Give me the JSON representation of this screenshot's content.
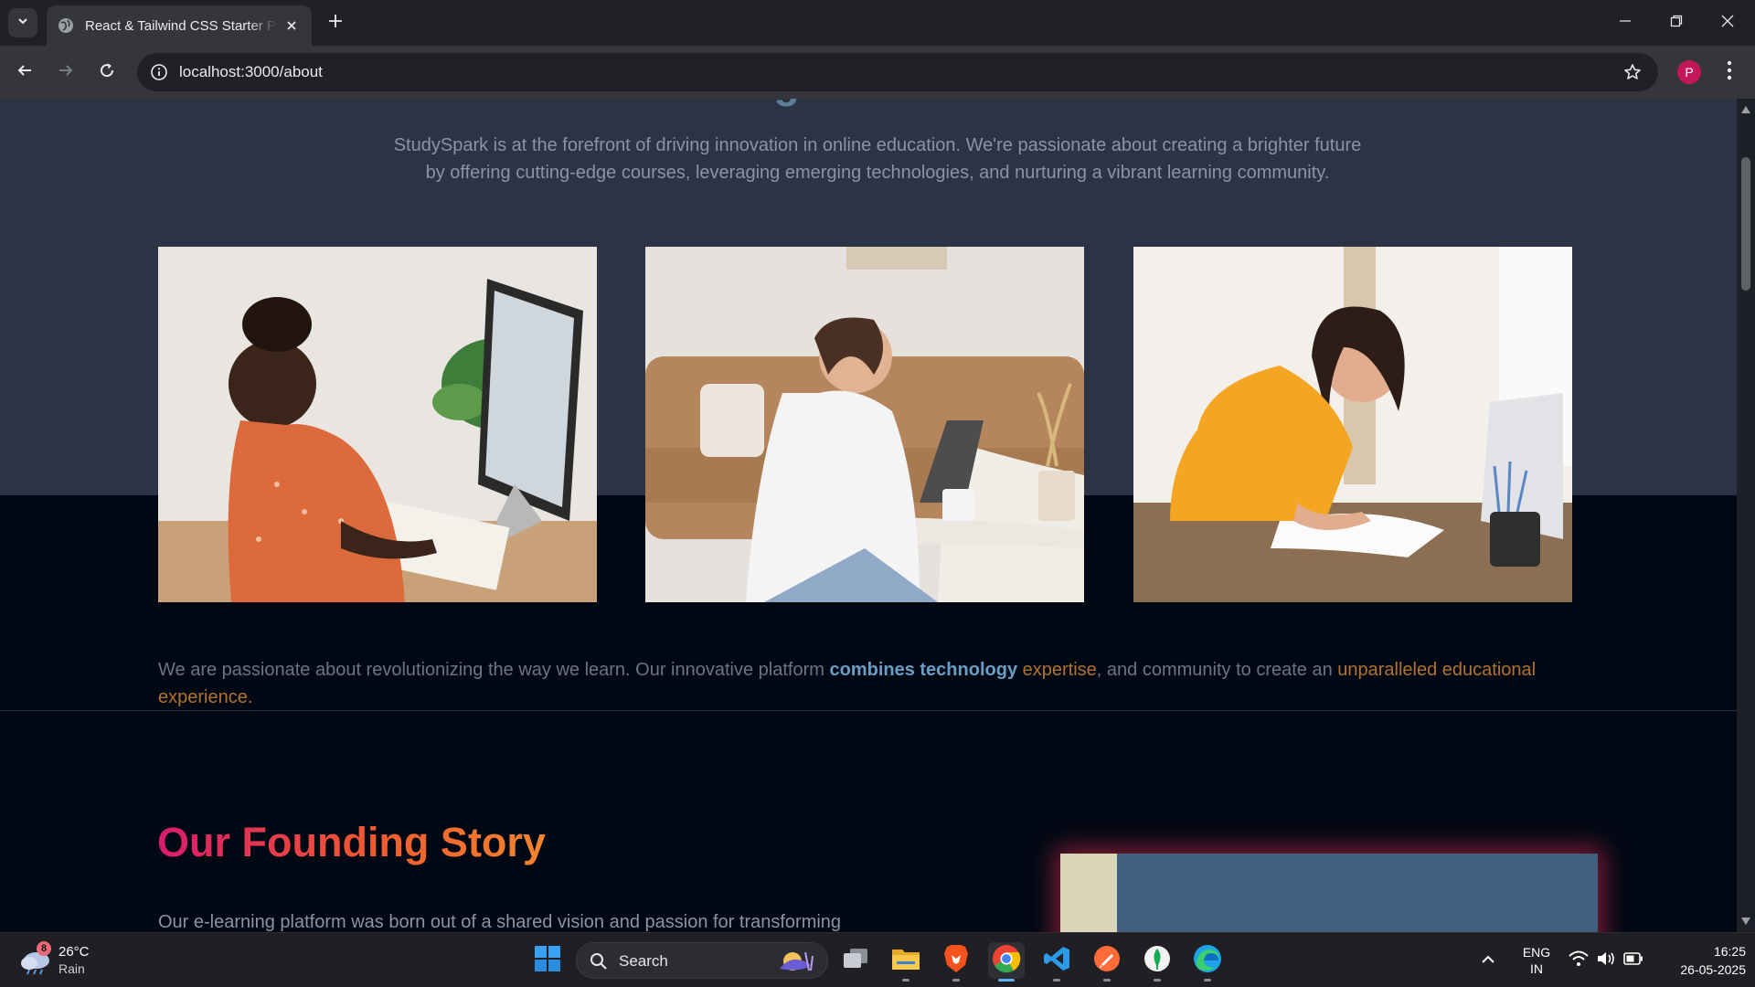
{
  "browser": {
    "tab_title": "React & Tailwind CSS Starter Pack",
    "url": "localhost:3000/about",
    "profile_initial": "P"
  },
  "page": {
    "heading_partial": "Brighter Future",
    "intro_text": "StudySpark is at the forefront of driving innovation in online education. We're passionate about creating a brighter future by offering cutting-edge courses, leveraging emerging technologies, and nurturing a vibrant learning community.",
    "mission": {
      "part1": "We are passionate about revolutionizing the way we learn. Our innovative platform ",
      "highlight1": "combines technology",
      "highlight2": " expertise",
      "part2": ", and community to create an ",
      "highlight3": "unparalleled educational experience."
    },
    "story_title": "Our Founding Story",
    "story_text": "Our e-learning platform was born out of a shared vision and passion for transforming"
  },
  "taskbar": {
    "weather_badge": "8",
    "temperature": "26°C",
    "condition": "Rain",
    "search_label": "Search",
    "lang_line1": "ENG",
    "lang_line2": "IN",
    "time": "16:25",
    "date": "26-05-2025"
  },
  "colors": {
    "page_bg": "#000814",
    "upper_section_bg": "#2c3344",
    "accent_blue": "#6a9ec5",
    "accent_amber": "#b2722f",
    "title_gradient_start": "#d91a6e",
    "title_gradient_end": "#f3842e"
  }
}
